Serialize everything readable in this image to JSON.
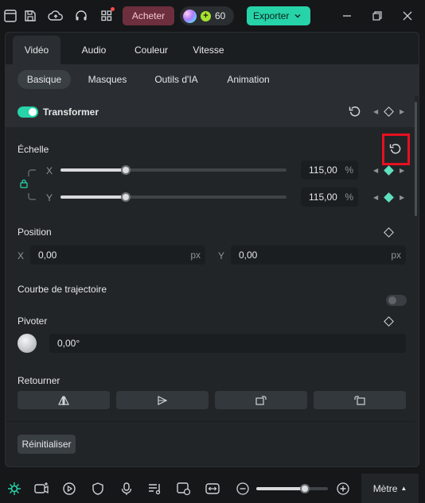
{
  "titlebar": {
    "buy_label": "Acheter",
    "credits": "60",
    "export_label": "Exporter"
  },
  "tabs_main": [
    "Vidéo",
    "Audio",
    "Couleur",
    "Vitesse"
  ],
  "tabs_sub": [
    "Basique",
    "Masques",
    "Outils d'IA",
    "Animation"
  ],
  "transform": {
    "title": "Transformer"
  },
  "scale": {
    "label": "Échelle",
    "x_label": "X",
    "x_value": "115,00",
    "y_label": "Y",
    "y_value": "115,00",
    "unit": "%",
    "slider_fraction": 0.29
  },
  "position": {
    "label": "Position",
    "x_label": "X",
    "x_value": "0,00",
    "y_label": "Y",
    "y_value": "0,00",
    "unit": "px"
  },
  "motion_curve": {
    "label": "Courbe de trajectoire"
  },
  "rotate": {
    "label": "Pivoter",
    "value": "0,00°"
  },
  "flip": {
    "label": "Retourner"
  },
  "reset_label": "Réinitialiser",
  "bottombar": {
    "zoom_fraction": 0.68,
    "metre_label": "Mètre"
  },
  "colors": {
    "accent": "#27d3a8",
    "buy": "#6d2f3d",
    "highlight": "#e8101f"
  }
}
